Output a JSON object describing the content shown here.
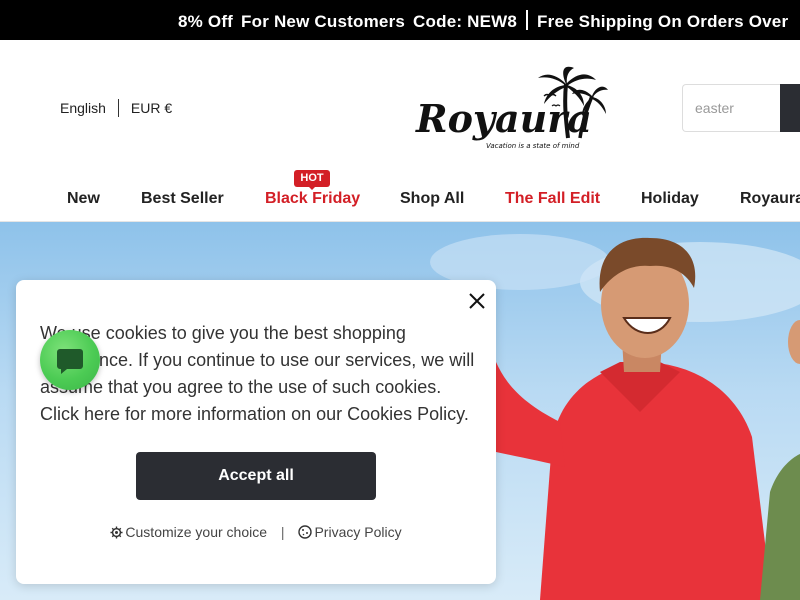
{
  "announcement": {
    "offer": "8% Off",
    "customers": "For New Customers",
    "code": "Code: NEW8",
    "shipping": "Free Shipping On Orders Over"
  },
  "header": {
    "language": "English",
    "currency": "EUR €",
    "logo_text": "Royaura",
    "logo_tagline": "Vacation is a state of mind",
    "search_placeholder": "easter"
  },
  "nav": {
    "items": [
      {
        "label": "New"
      },
      {
        "label": "Best Seller"
      },
      {
        "label": "Black Friday",
        "badge": "HOT"
      },
      {
        "label": "Shop All"
      },
      {
        "label": "The Fall Edit"
      },
      {
        "label": "Holiday"
      },
      {
        "label": "Royaura"
      }
    ]
  },
  "cookie": {
    "message": "We use cookies to give you the best shopping experience. If you continue to use our services, we will assume that you agree to the use of such cookies. Click here for more information on our Cookies Policy.",
    "accept_label": "Accept all",
    "customize_label": "Customize your choice",
    "separator": "|",
    "privacy_label": "Privacy Policy"
  },
  "colors": {
    "accent_red": "#d31f26",
    "dark_button": "#2b2d33",
    "chat_green": "#4ccb54"
  },
  "icons": [
    "close-icon",
    "gear-icon",
    "cookie-icon",
    "chat-icon",
    "palm-tree-icon"
  ]
}
